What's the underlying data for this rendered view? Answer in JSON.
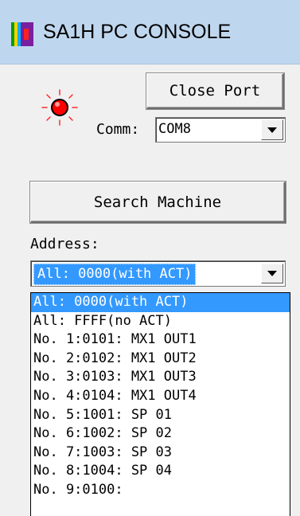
{
  "window": {
    "title": "SA1H PC CONSOLE"
  },
  "status": {
    "led_color": "#ff0000",
    "icon": "red-led-indicator"
  },
  "port": {
    "close_label": "Close Port"
  },
  "comm": {
    "label": "Comm:",
    "value": "COM8"
  },
  "search": {
    "label": "Search Machine"
  },
  "address": {
    "label": "Address:",
    "selected": "All: 0000(with ACT)",
    "options": [
      "All: 0000(with ACT)",
      "All: FFFF(no ACT)",
      "No. 1:0101: MX1 OUT1",
      "No. 2:0102: MX1 OUT2",
      "No. 3:0103: MX1 OUT3",
      "No. 4:0104: MX1 OUT4",
      "No. 5:1001: SP 01",
      "No. 6:1002: SP 02",
      "No. 7:1003: SP 03",
      "No. 8:1004: SP 04",
      "No. 9:0100:"
    ]
  },
  "colors": {
    "selection": "#3399ff",
    "titlebar": "#bfd7ee",
    "window_bg": "#f0f0f0"
  }
}
